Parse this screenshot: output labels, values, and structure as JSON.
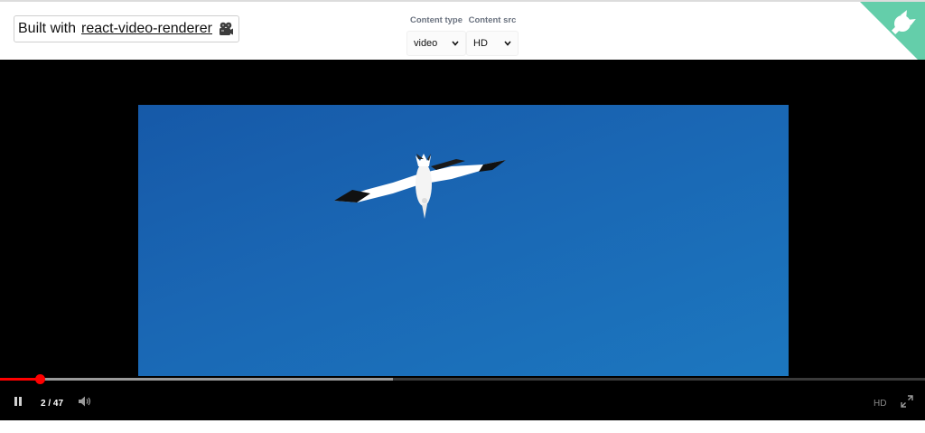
{
  "header": {
    "built_prefix": "Built with",
    "built_link": "react-video-renderer",
    "content_type": {
      "label": "Content type",
      "value": "video"
    },
    "content_src": {
      "label": "Content src",
      "value": "HD"
    }
  },
  "icons": {
    "camera": "film-camera-icon",
    "github": "github-corner-icon",
    "pause": "pause-icon",
    "volume": "volume-icon",
    "fullscreen": "fullscreen-icon"
  },
  "player": {
    "time": "2 / 47",
    "quality": "HD",
    "progress_fraction": 0.0426,
    "buffered_fraction": 0.425
  },
  "colors": {
    "progress_played": "#ff0000",
    "corner_badge": "#64ceaa",
    "player_bg": "#000000",
    "video_sky": "#1a67b4"
  }
}
